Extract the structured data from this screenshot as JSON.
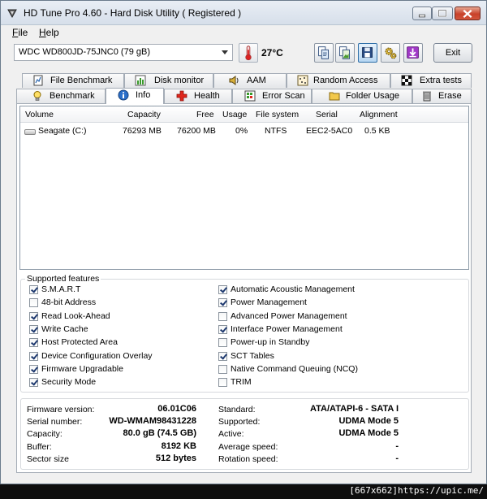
{
  "window": {
    "title": "HD Tune Pro 4.60 - Hard Disk Utility ( Registered )"
  },
  "menu": {
    "file": "File",
    "help": "Help"
  },
  "toolbar": {
    "drive": "WDC WD800JD-75JNC0 (79 gB)",
    "temperature": "27°C",
    "exit_label": "Exit"
  },
  "tabs": {
    "top": [
      {
        "label": "File Benchmark",
        "icon": "file-benchmark-icon"
      },
      {
        "label": "Disk monitor",
        "icon": "disk-monitor-icon"
      },
      {
        "label": "AAM",
        "icon": "speaker-icon"
      },
      {
        "label": "Random Access",
        "icon": "random-access-icon"
      },
      {
        "label": "Extra tests",
        "icon": "flag-icon"
      }
    ],
    "bottom": [
      {
        "label": "Benchmark",
        "icon": "lightbulb-icon"
      },
      {
        "label": "Info",
        "icon": "info-icon"
      },
      {
        "label": "Health",
        "icon": "health-cross-icon"
      },
      {
        "label": "Error Scan",
        "icon": "error-scan-icon"
      },
      {
        "label": "Folder Usage",
        "icon": "folder-icon"
      },
      {
        "label": "Erase",
        "icon": "trash-icon"
      }
    ],
    "active": "Info"
  },
  "volumes": {
    "columns": [
      "Volume",
      "Capacity",
      "Free",
      "Usage",
      "File system",
      "Serial",
      "Alignment"
    ],
    "rows": [
      {
        "volume": "Seagate (C:)",
        "capacity": "76293 MB",
        "free": "76200 MB",
        "usage": "0%",
        "filesystem": "NTFS",
        "serial": "EEC2-5AC0",
        "alignment": "0.5 KB"
      }
    ]
  },
  "features": {
    "title": "Supported features",
    "left": [
      {
        "label": "S.M.A.R.T",
        "checked": true
      },
      {
        "label": "48-bit Address",
        "checked": false
      },
      {
        "label": "Read Look-Ahead",
        "checked": true
      },
      {
        "label": "Write Cache",
        "checked": true
      },
      {
        "label": "Host Protected Area",
        "checked": true
      },
      {
        "label": "Device Configuration Overlay",
        "checked": true
      },
      {
        "label": "Firmware Upgradable",
        "checked": true
      },
      {
        "label": "Security Mode",
        "checked": true
      }
    ],
    "right": [
      {
        "label": "Automatic Acoustic Management",
        "checked": true
      },
      {
        "label": "Power Management",
        "checked": true
      },
      {
        "label": "Advanced Power Management",
        "checked": false
      },
      {
        "label": "Interface Power Management",
        "checked": true
      },
      {
        "label": "Power-up in Standby",
        "checked": false
      },
      {
        "label": "SCT Tables",
        "checked": true
      },
      {
        "label": "Native Command Queuing (NCQ)",
        "checked": false
      },
      {
        "label": "TRIM",
        "checked": false
      }
    ]
  },
  "info": {
    "left": [
      {
        "label": "Firmware version:",
        "value": "06.01C06"
      },
      {
        "label": "Serial number:",
        "value": "WD-WMAM98431228"
      },
      {
        "label": "Capacity:",
        "value": "80.0 gB (74.5 GB)"
      },
      {
        "label": "Buffer:",
        "value": "8192 KB"
      },
      {
        "label": "Sector size",
        "value": "512 bytes"
      }
    ],
    "right": [
      {
        "label": "Standard:",
        "value": "ATA/ATAPI-6 - SATA I"
      },
      {
        "label": "Supported:",
        "value": "UDMA Mode 5"
      },
      {
        "label": "Active:",
        "value": "UDMA Mode 5"
      },
      {
        "label": "Average speed:",
        "value": "-"
      },
      {
        "label": "Rotation speed:",
        "value": "-"
      }
    ]
  },
  "watermark": "[667x662]https://upic.me/"
}
